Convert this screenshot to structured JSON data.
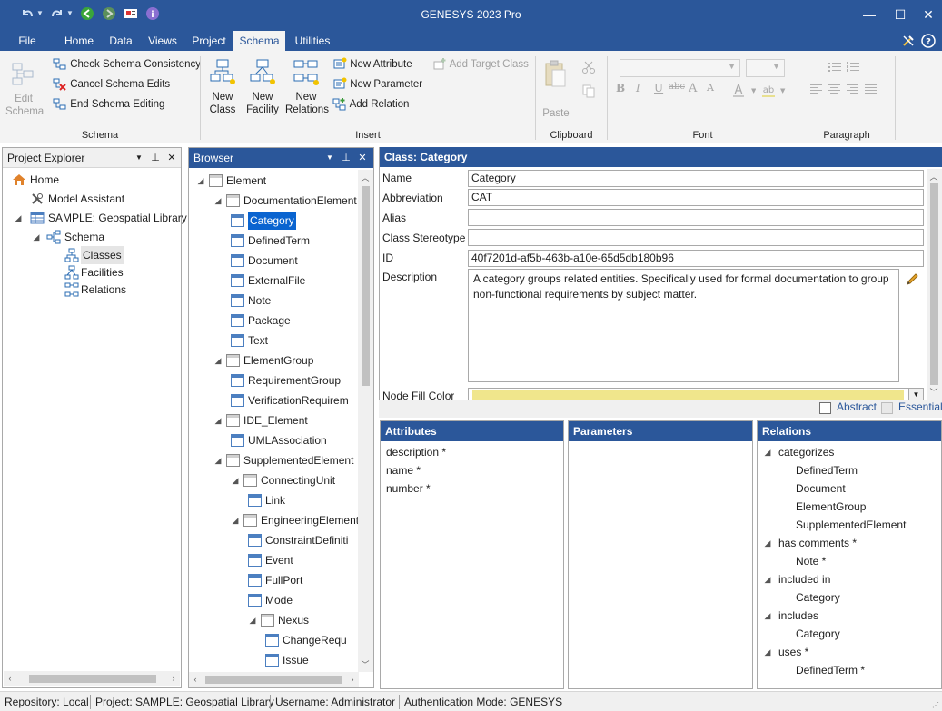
{
  "window": {
    "title": "GENESYS 2023 Pro",
    "minimize": "—",
    "maximize": "☐",
    "close": "✕"
  },
  "ribbon_tabs": [
    "File",
    "Home",
    "Data",
    "Views",
    "Project",
    "Schema",
    "Utilities"
  ],
  "active_tab": "Schema",
  "ribbon": {
    "schema_group": {
      "label": "Schema",
      "edit_schema": "Edit Schema",
      "check_consistency": "Check Schema Consistency",
      "cancel_edits": "Cancel Schema Edits",
      "end_editing": "End Schema Editing"
    },
    "insert_group": {
      "label": "Insert",
      "new_class": "New Class",
      "new_facility": "New Facility",
      "new_relations": "New Relations",
      "new_attribute": "New Attribute",
      "new_parameter": "New Parameter",
      "add_relation": "Add Relation",
      "add_target_class": "Add Target Class"
    },
    "clipboard_group": {
      "label": "Clipboard",
      "paste": "Paste"
    },
    "font_group": {
      "label": "Font",
      "buttons": [
        "B",
        "I",
        "U",
        "abc",
        "A",
        "A"
      ]
    },
    "paragraph_group": {
      "label": "Paragraph"
    }
  },
  "project_explorer": {
    "title": "Project Explorer",
    "items": [
      {
        "label": "Home",
        "icon": "home-icon"
      },
      {
        "label": "Model Assistant",
        "icon": "wrench-icon"
      },
      {
        "label": "SAMPLE: Geospatial Library",
        "icon": "table-icon"
      },
      {
        "label": "Schema",
        "icon": "schema-icon"
      },
      {
        "label": "Classes",
        "icon": "classes-icon"
      },
      {
        "label": "Facilities",
        "icon": "facilities-icon"
      },
      {
        "label": "Relations",
        "icon": "relations-icon"
      }
    ]
  },
  "browser": {
    "title": "Browser",
    "items": [
      {
        "label": "Element",
        "expand": "◢"
      },
      {
        "label": "DocumentationElement",
        "expand": "◢"
      },
      {
        "label": "Category",
        "selected": true
      },
      {
        "label": "DefinedTerm"
      },
      {
        "label": "Document"
      },
      {
        "label": "ExternalFile"
      },
      {
        "label": "Note"
      },
      {
        "label": "Package"
      },
      {
        "label": "Text"
      },
      {
        "label": "ElementGroup",
        "expand": "◢"
      },
      {
        "label": "RequirementGroup"
      },
      {
        "label": "VerificationRequirem"
      },
      {
        "label": "IDE_Element",
        "expand": "◢"
      },
      {
        "label": "UMLAssociation"
      },
      {
        "label": "SupplementedElement",
        "expand": "◢"
      },
      {
        "label": "ConnectingUnit",
        "expand": "◢"
      },
      {
        "label": "Link"
      },
      {
        "label": "EngineeringElement",
        "expand": "◢"
      },
      {
        "label": "ConstraintDefiniti"
      },
      {
        "label": "Event"
      },
      {
        "label": "FullPort"
      },
      {
        "label": "Mode"
      },
      {
        "label": "Nexus",
        "expand": "◢"
      },
      {
        "label": "ChangeRequ"
      },
      {
        "label": "Issue"
      }
    ]
  },
  "class_panel": {
    "title": "Class:  Category",
    "labels": {
      "name": "Name",
      "abbreviation": "Abbreviation",
      "alias": "Alias",
      "stereotype": "Class Stereotype",
      "id": "ID",
      "description": "Description",
      "node_fill": "Node Fill Color"
    },
    "values": {
      "name": "Category",
      "abbreviation": "CAT",
      "alias": "",
      "stereotype": "",
      "id": "40f7201d-af5b-463b-a10e-65d5db180b96",
      "description": "A category groups related entities. Specifically used for formal documentation to group non-functional requirements by subject matter."
    },
    "node_fill_color": "#f0e68c",
    "abstract_label": "Abstract",
    "essential_label": "Essential"
  },
  "attributes": {
    "title": "Attributes",
    "items": [
      "description *",
      "name *",
      "number *"
    ]
  },
  "parameters": {
    "title": "Parameters",
    "items": []
  },
  "relations": {
    "title": "Relations",
    "groups": [
      {
        "label": "categorizes",
        "children": [
          "DefinedTerm",
          "Document",
          "ElementGroup",
          "SupplementedElement"
        ]
      },
      {
        "label": "has comments *",
        "children": [
          "Note *"
        ]
      },
      {
        "label": "included in",
        "children": [
          "Category"
        ]
      },
      {
        "label": "includes",
        "children": [
          "Category"
        ]
      },
      {
        "label": "uses *",
        "children": [
          "DefinedTerm *"
        ]
      }
    ]
  },
  "status_bar": {
    "repository": "Repository: Local",
    "project": "Project: SAMPLE: Geospatial Library",
    "username": "Username: Administrator",
    "auth": "Authentication Mode: GENESYS"
  },
  "colors": {
    "accent": "#2b579a",
    "selection": "#0a64d0",
    "ribbon_bg": "#f3f3f3"
  }
}
